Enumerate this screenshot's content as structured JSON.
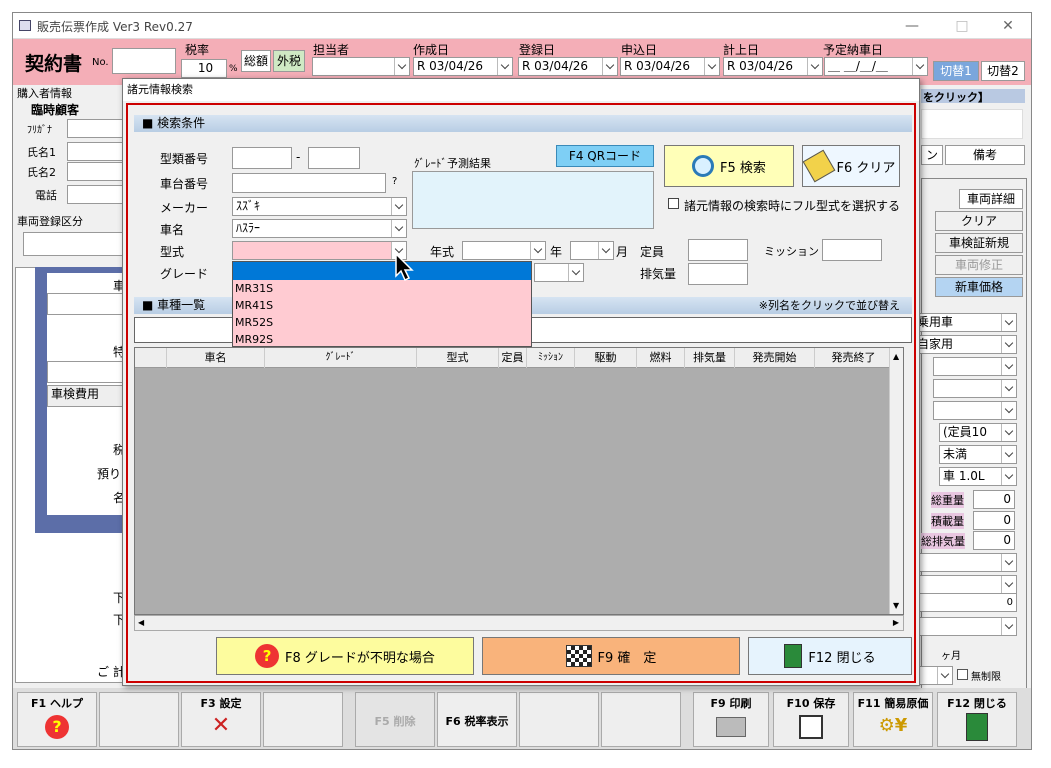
{
  "app": {
    "title": "販売伝票作成 Ver3 Rev0.27",
    "min": "—",
    "max": "□",
    "close": "✕"
  },
  "header": {
    "contract_title": "契約書",
    "no_label": "No.",
    "tax_rate_label": "税率",
    "tax_rate": "10",
    "percent": "%",
    "tax_incl": "総額",
    "tax_excl": "外税",
    "staff_label": "担当者",
    "created_label": "作成日",
    "created": "R 03/04/26",
    "registered_label": "登録日",
    "registered": "R 03/04/26",
    "applied_label": "申込日",
    "applied": "R 03/04/26",
    "booked_label": "計上日",
    "booked": "R 03/04/26",
    "delivery_label": "予定納車日",
    "delivery": "＿ ＿/＿/＿",
    "switch1": "切替1",
    "switch2": "切替2"
  },
  "bg": {
    "buyer_info": "購入者情報",
    "temp_customer": "臨時顧客",
    "furigana": "ﾌﾘｶﾞﾅ",
    "name1": "氏名1",
    "name2": "氏名2",
    "phone": "電話",
    "reg_class": "車両登録区分",
    "click_hint": "をクリック】",
    "remarks_btn": "備考",
    "n_btn": "ン",
    "detail_btn": "車両詳細",
    "clear_btn": "クリア",
    "inspection_btn": "車検証新規",
    "modify_btn": "車両修正",
    "newprice_btn": "新車価格",
    "use1": "乗用車",
    "use2": "自家用",
    "seat": "(定員10",
    "under": "未満",
    "car10": "車 1.0L",
    "gross_w": "総重量",
    "load_w": "積載量",
    "total_disp": "総排気量",
    "zero": "0",
    "inspection_cost": "車検費用",
    "car_lbl": "車",
    "toku": "特",
    "zei": "税",
    "azu": "預り",
    "na": "名",
    "shita1": "下",
    "shita2": "下",
    "goukei": "ご 計",
    "kagetsu": "ヶ月",
    "museigen": "無制限"
  },
  "fkeys": {
    "f1": "F1 ヘルプ",
    "f3": "F3 設定",
    "f5": "F5 削除",
    "f6": "F6 税率表示",
    "f9": "F9 印刷",
    "f10": "F10 保存",
    "f11": "F11 簡易原価",
    "f12": "F12 閉じる"
  },
  "dialog": {
    "title": "諸元情報検索",
    "search_section": "■ 検索条件",
    "model_no_label": "型類番号",
    "dash": "-",
    "chassis_label": "車台番号",
    "question": "?",
    "maker_label": "メーカー",
    "maker": "ｽｽﾞｷ",
    "carname_label": "車名",
    "carname": "ﾊｽﾗｰ",
    "type_label": "型式",
    "grade_label": "グレード",
    "year_label": "年式",
    "year_unit": "年",
    "month_unit": "月",
    "capacity_label": "定員",
    "mission_label": "ミッション",
    "displacement_label": "排気量",
    "grade_predict": "ｸﾞﾚｰﾄﾞ予測結果",
    "qr_btn": "F4 QRコード",
    "search_btn": "F5 検索",
    "clear_btn": "F6 クリア",
    "fullmodel_check": "諸元情報の検索時にフル型式を選択する",
    "dropdown_options": [
      "",
      "MR31S",
      "MR41S",
      "MR52S",
      "MR92S"
    ],
    "list_section": "■ 車種一覧",
    "sort_hint": "※列名をクリックで並び替え",
    "columns": [
      "車名",
      "ｸﾞﾚｰﾄﾞ",
      "型式",
      "定員",
      "ﾐｯｼｮﾝ",
      "駆動",
      "燃料",
      "排気量",
      "発売開始",
      "発売終了"
    ],
    "f8_btn": "F8 グレードが不明な場合",
    "f9_btn": "F9 確　定",
    "f12_btn": "F12 閉じる"
  }
}
